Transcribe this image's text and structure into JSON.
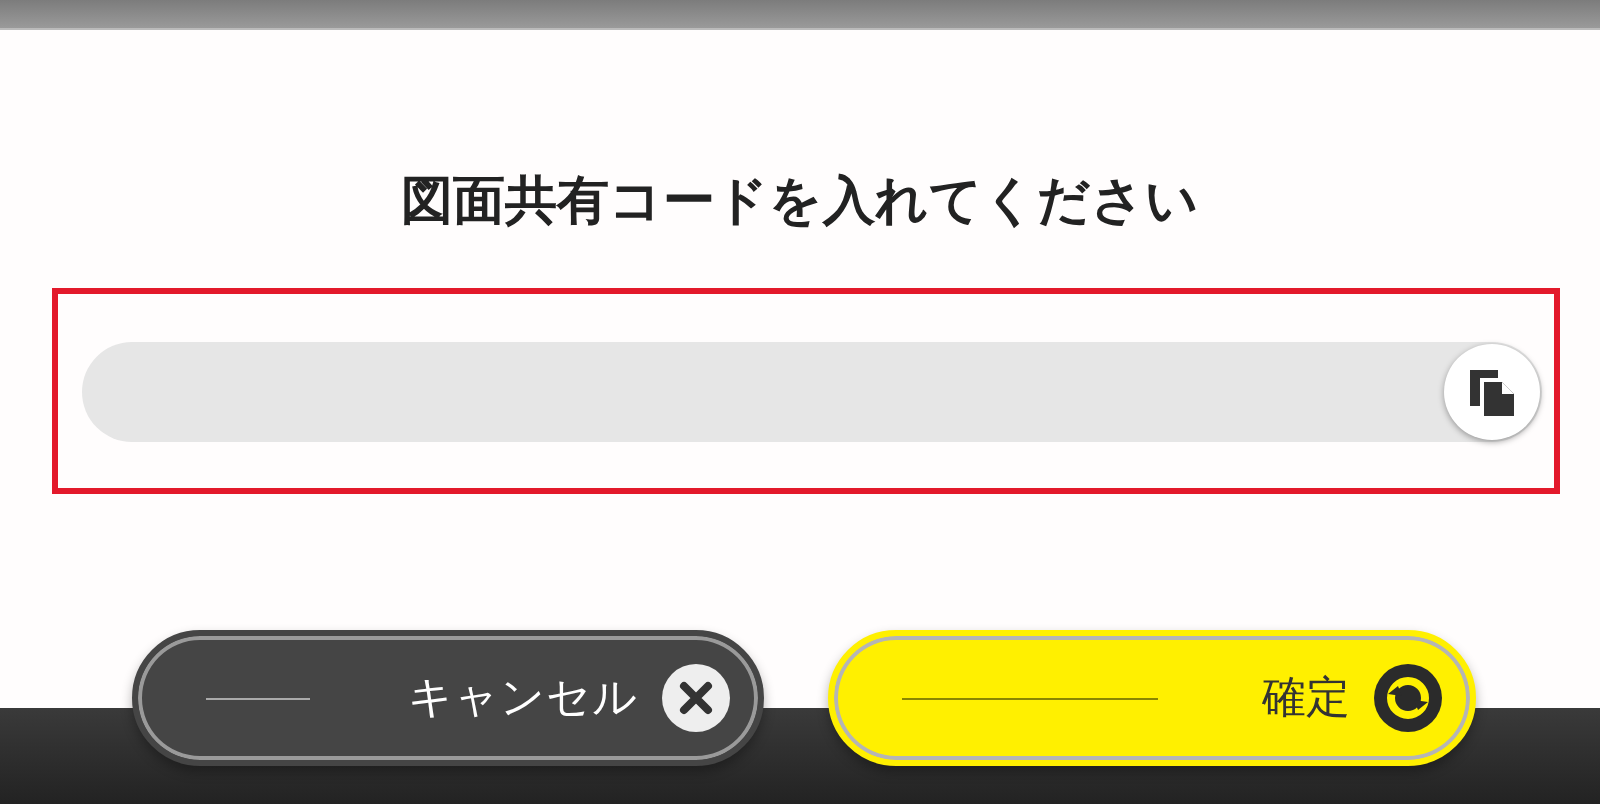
{
  "title": "図面共有コードを入れてください",
  "code_field": {
    "highlighted": true
  },
  "buttons": [
    {
      "label": "キャンセル",
      "kind": "cancel"
    },
    {
      "label": "確定",
      "kind": "confirm"
    }
  ]
}
